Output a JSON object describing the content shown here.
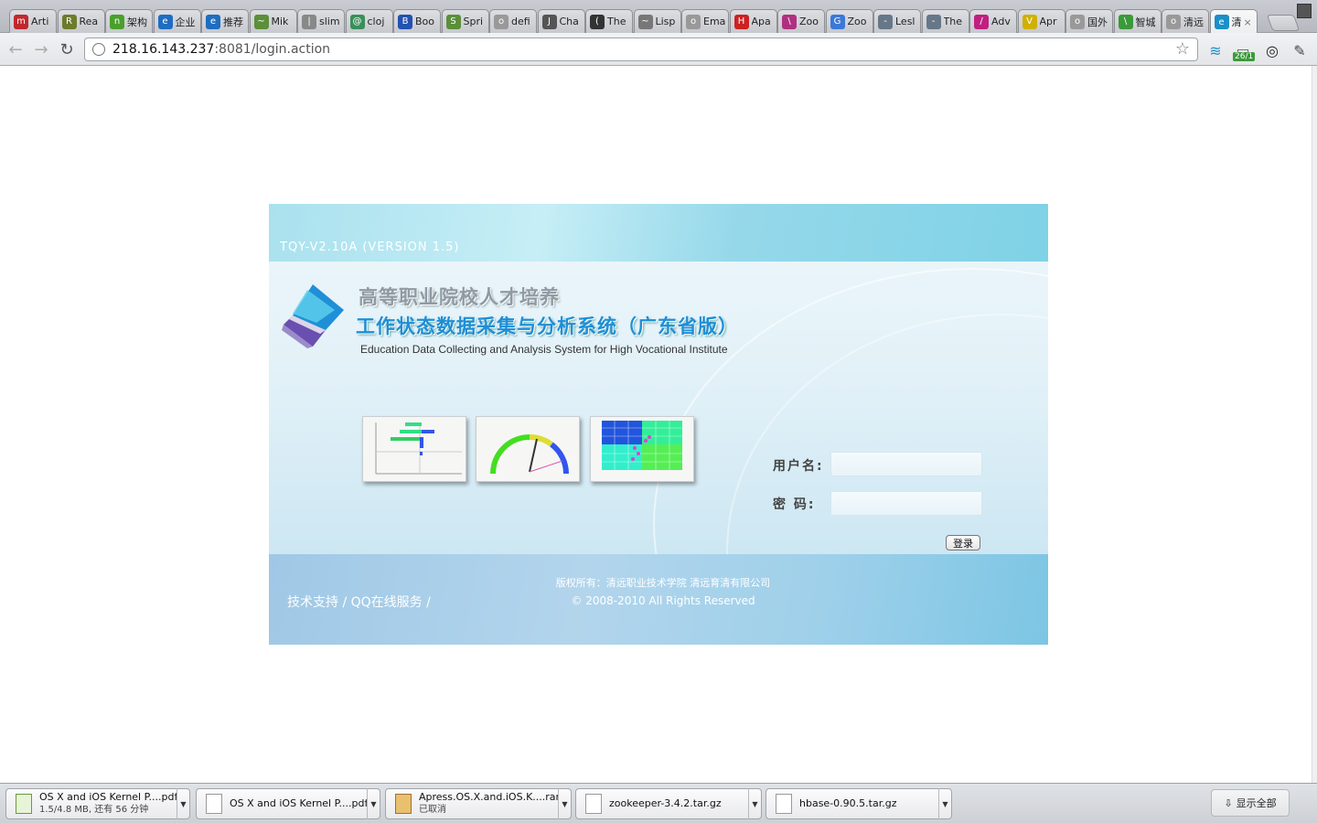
{
  "tabs": [
    {
      "label": "Arti",
      "color": "#c0282d",
      "glyph": "m"
    },
    {
      "label": "Rea",
      "color": "#6b7c2c",
      "glyph": "R"
    },
    {
      "label": "架构",
      "color": "#4aa02c",
      "glyph": "n"
    },
    {
      "label": "企业",
      "color": "#1f6dc1",
      "glyph": "e"
    },
    {
      "label": "推荐",
      "color": "#1f6dc1",
      "glyph": "e"
    },
    {
      "label": "Mik",
      "color": "#5b8f3a",
      "glyph": "~"
    },
    {
      "label": "slim",
      "color": "#888888",
      "glyph": "|"
    },
    {
      "label": "cloj",
      "color": "#3a8f5a",
      "glyph": "@"
    },
    {
      "label": "Boo",
      "color": "#2251b0",
      "glyph": "B"
    },
    {
      "label": "Spri",
      "color": "#5a8f3a",
      "glyph": "S"
    },
    {
      "label": "defi",
      "color": "#999999",
      "glyph": "o"
    },
    {
      "label": "Cha",
      "color": "#555555",
      "glyph": "J"
    },
    {
      "label": "The",
      "color": "#333333",
      "glyph": "("
    },
    {
      "label": "Lisp",
      "color": "#777777",
      "glyph": "~"
    },
    {
      "label": "Ema",
      "color": "#999999",
      "glyph": "o"
    },
    {
      "label": "Apa",
      "color": "#cc2222",
      "glyph": "H"
    },
    {
      "label": "Zoo",
      "color": "#b03080",
      "glyph": "\\"
    },
    {
      "label": "Zoo",
      "color": "#3c78d8",
      "glyph": "G"
    },
    {
      "label": "Lesl",
      "color": "#667788",
      "glyph": "-"
    },
    {
      "label": "The",
      "color": "#667788",
      "glyph": "-"
    },
    {
      "label": "Adv",
      "color": "#c02080",
      "glyph": "/"
    },
    {
      "label": "Apr",
      "color": "#d0b000",
      "glyph": "V"
    },
    {
      "label": "国外",
      "color": "#999999",
      "glyph": "o"
    },
    {
      "label": "智城",
      "color": "#3a9a3a",
      "glyph": "\\"
    },
    {
      "label": "清远",
      "color": "#999999",
      "glyph": "o"
    },
    {
      "label": "清",
      "color": "#1b8fc8",
      "glyph": "e",
      "active": true
    }
  ],
  "toolbar": {
    "back": "←",
    "forward": "→",
    "reload": "↻",
    "url_host": "218.16.143.237",
    "url_path": ":8081/login.action",
    "star": "☆",
    "ext_badge": "26/1"
  },
  "login": {
    "version": "TQY-V2.10A (VERSION 1.5)",
    "title_line1": "高等职业院校人才培养",
    "title_line2": "工作状态数据采集与分析系统（广东省版）",
    "subtitle": "Education Data Collecting and Analysis System for High Vocational Institute",
    "username_label": "用户名:",
    "password_label": "密  码:",
    "username_value": "",
    "password_value": "",
    "login_button": "登录",
    "support_links": "技术支持 / QQ在线服务 /",
    "copyright_line1": "版权所有：清远职业技术学院 清远育清有限公司",
    "copyright_line2": "© 2008-2010 All Rights Reserved",
    "colors": {
      "title_blue": "#1e8fd6",
      "title_gray": "#8f9aa3"
    }
  },
  "downloads": [
    {
      "name": "OS X and iOS Kernel P....pdf",
      "status": "1.5/4.8 MB, 还有 56 分钟",
      "icon": "pdf-progress-icon"
    },
    {
      "name": "OS X and iOS Kernel P....pdf",
      "status": "",
      "icon": "pdf-icon"
    },
    {
      "name": "Apress.OS.X.and.iOS.K....rar",
      "status": "已取消",
      "icon": "archive-icon"
    },
    {
      "name": "zookeeper-3.4.2.tar.gz",
      "status": "",
      "icon": "file-icon"
    },
    {
      "name": "hbase-0.90.5.tar.gz",
      "status": "",
      "icon": "file-icon"
    }
  ],
  "shelf": {
    "show_all": "显示全部"
  }
}
